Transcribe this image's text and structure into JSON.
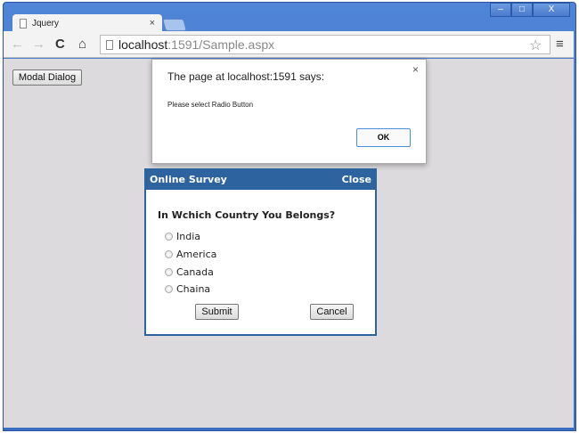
{
  "browser": {
    "tab_title": "Jquery",
    "tab_close": "×",
    "url_host": "localhost",
    "url_path": ":1591/Sample.aspx",
    "minimize": "–",
    "maximize": "□",
    "close": "X"
  },
  "page": {
    "modal_button": "Modal Dialog"
  },
  "alert": {
    "title": "The page at localhost:1591 says:",
    "message": "Please select Radio Button",
    "ok": "OK",
    "close": "×"
  },
  "survey": {
    "title": "Online Survey",
    "close": "Close",
    "question": "In Wchich Country You Belongs?",
    "options": [
      "India",
      "America",
      "Canada",
      "Chaina"
    ],
    "submit": "Submit",
    "cancel": "Cancel"
  }
}
